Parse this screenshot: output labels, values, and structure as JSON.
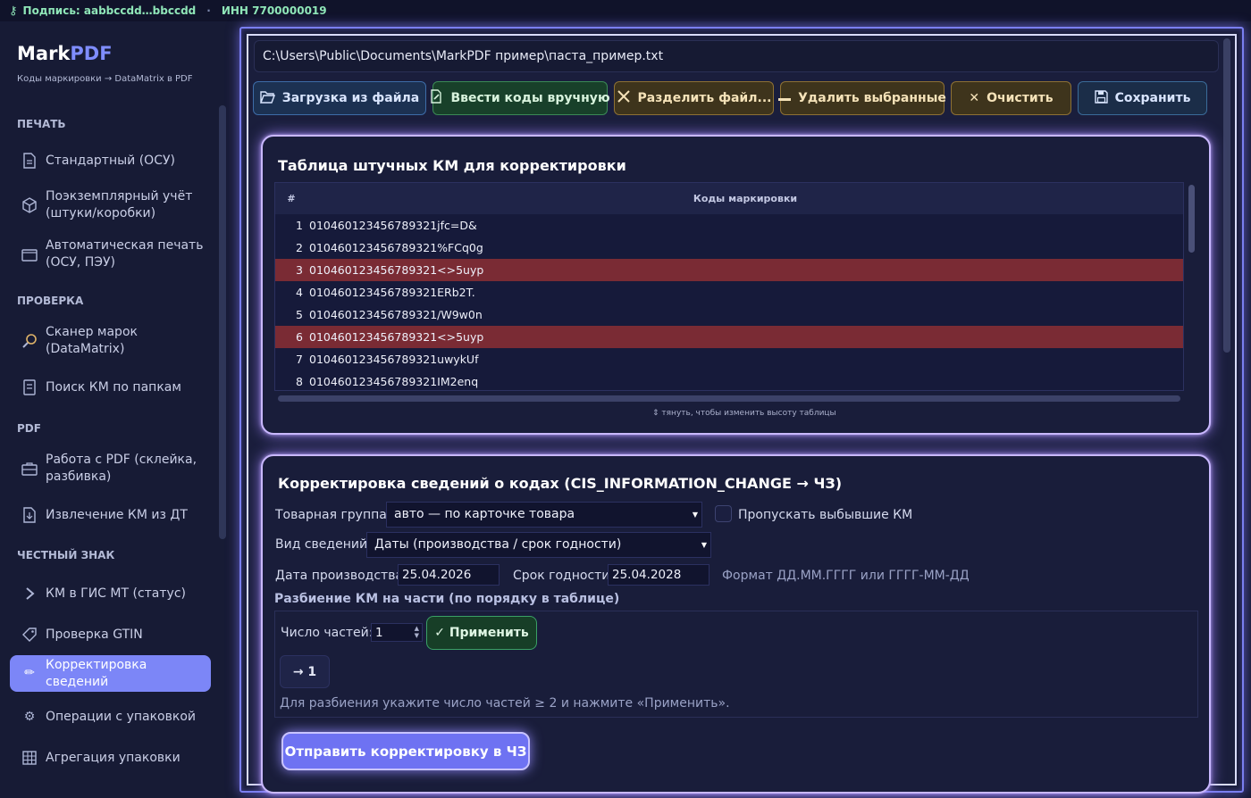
{
  "topbar": {
    "signature": "Подпись: aabbccdd…bbccdd",
    "inn": "ИНН 7700000019"
  },
  "brand": {
    "name_a": "Mark",
    "name_b": "PDF",
    "subtitle": "Коды маркировки → DataMatrix в PDF"
  },
  "sidebar": {
    "sections": [
      "ПЕЧАТЬ",
      "ПРОВЕРКА",
      "PDF",
      "ЧЕСТНЫЙ ЗНАК"
    ],
    "items": [
      {
        "label": "Стандартный (ОСУ)",
        "icon": "document-icon"
      },
      {
        "label": "Поэкземплярный учёт (штуки/коробки)",
        "icon": "box-icon"
      },
      {
        "label": "Автоматическая печать (ОСУ, ПЭУ)",
        "icon": "printer-folder-icon"
      },
      {
        "label": "Сканер марок (DataMatrix)",
        "icon": "scanner-icon"
      },
      {
        "label": "Поиск КМ по папкам",
        "icon": "search-document-icon"
      },
      {
        "label": "Работа с PDF (склейка, разбивка)",
        "icon": "briefcase-icon"
      },
      {
        "label": "Извлечение КМ из ДТ",
        "icon": "extract-icon"
      },
      {
        "label": "КМ в ГИС МТ (статус)",
        "icon": "arrow-icon"
      },
      {
        "label": "Проверка GTIN",
        "icon": "tag-icon"
      },
      {
        "label": "Корректировка сведений",
        "icon": "pencil-icon"
      },
      {
        "label": "Операции с упаковкой",
        "icon": "gear-icon"
      },
      {
        "label": "Агрегация упаковки",
        "icon": "grid-icon"
      }
    ]
  },
  "main": {
    "file_path": "C:\\Users\\Public\\Documents\\MarkPDF пример\\паста_пример.txt",
    "toolbar": [
      {
        "label": "Загрузка из файла",
        "icon": "folder-open-icon"
      },
      {
        "label": "Ввести коды вручную",
        "icon": "edit-icon"
      },
      {
        "label": "Разделить файл...",
        "icon": "tools-icon"
      },
      {
        "label": "Удалить выбранные",
        "icon": "minus-icon"
      },
      {
        "label": "Очистить",
        "icon": "close-icon"
      },
      {
        "label": "Сохранить",
        "icon": "save-icon"
      }
    ],
    "table_panel": {
      "title": "Таблица штучных КМ для корректировки",
      "col_num": "#",
      "col_codes": "Коды маркировки",
      "rows": [
        {
          "n": "1",
          "code": "010460123456789321jfc=D&",
          "highlight": false
        },
        {
          "n": "2",
          "code": "010460123456789321%FCq0g",
          "highlight": false
        },
        {
          "n": "3",
          "code": "010460123456789321<>5uyp",
          "highlight": true
        },
        {
          "n": "4",
          "code": "010460123456789321ERb2T.",
          "highlight": false
        },
        {
          "n": "5",
          "code": "010460123456789321/W9w0n",
          "highlight": false
        },
        {
          "n": "6",
          "code": "010460123456789321<>5uyp",
          "highlight": true
        },
        {
          "n": "7",
          "code": "010460123456789321uwykUf",
          "highlight": false
        },
        {
          "n": "8",
          "code": "010460123456789321IM2enq",
          "highlight": false
        }
      ],
      "resize_hint": "⇕ тянуть, чтобы изменить высоту таблицы",
      "highlight_color": "#7a2b34"
    },
    "correction_panel": {
      "title": "Корректировка сведений о кодах (CIS_INFORMATION_CHANGE → ЧЗ)",
      "product_group_label": "Товарная группа:",
      "product_group_value": "авто — по карточке товара",
      "skip_retired_label": "Пропускать выбывшие КМ",
      "info_type_label": "Вид сведений:",
      "info_type_value": "Даты (производства / срок годности)",
      "production_date_label": "Дата производства:",
      "production_date_value": "25.04.2026",
      "expiry_label": "Срок годности:",
      "expiry_value": "25.04.2028",
      "format_hint": "Формат ДД.ММ.ГГГГ или ГГГГ-ММ-ДД",
      "split_title": "Разбиение КМ на части (по порядку в таблице)",
      "parts_label": "Число частей:",
      "parts_value": "1",
      "apply_label": "✓ Применить",
      "part_chip": "→ 1",
      "split_hint": "Для разбиения укажите число частей ≥ 2 и нажмите «Применить».",
      "send_label": "Отправить корректировку в ЧЗ"
    }
  },
  "colors": {
    "accent": "#7c86f7",
    "background": "#161a33",
    "panel_glow": "#c9b8ff"
  }
}
